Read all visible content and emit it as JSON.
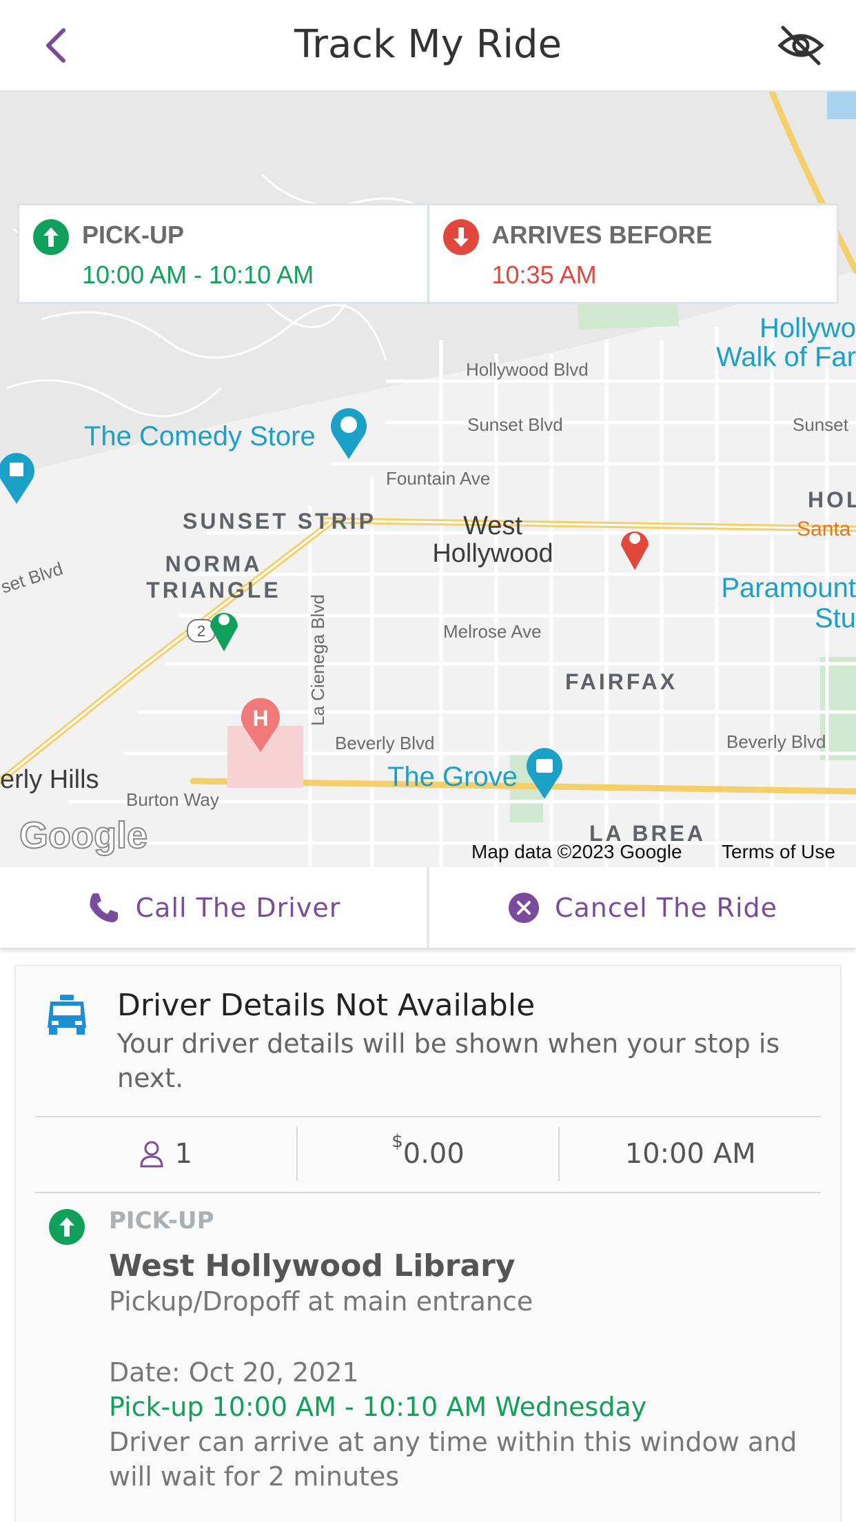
{
  "header": {
    "title": "Track My Ride",
    "back_icon": "chevron-left-icon",
    "privacy_icon": "eye-off-icon",
    "accent": "#7a4b9a"
  },
  "map": {
    "labels": {
      "hollywood_blvd": "Hollywood Blvd",
      "sunset_blvd": "Sunset Blvd",
      "sunset_blvd_right": "Sunset",
      "fountain_ave": "Fountain Ave",
      "sunset_strip": "SUNSET STRIP",
      "west_hollywood": "West Hollywood",
      "norma_triangle": "NORMA TRIANGLE",
      "la_cienega": "La Cienega Blvd",
      "melrose_ave": "Melrose Ave",
      "fairfax": "FAIRFAX",
      "beverly_blvd": "Beverly Blvd",
      "beverly_blvd_right": "Beverly Blvd",
      "burton_way": "Burton Way",
      "beverly_hills": "erly Hills",
      "la_brea": "LA BREA",
      "comedy_store": "The Comedy Store",
      "the_grove": "The Grove",
      "walk_of_fame": "Hollywo Walk of Far",
      "paramount": "Paramount Stu",
      "santa": "Santa",
      "hol": "HOL",
      "set_blvd": "set Blvd",
      "route_badge": "2"
    },
    "attribution": "Map data ©2023 Google",
    "terms": "Terms of Use",
    "google_logo": "Google"
  },
  "time_card": {
    "pickup_label": "PICK-UP",
    "pickup_value": "10:00 AM - 10:10 AM",
    "arrive_label": "ARRIVES BEFORE",
    "arrive_value": "10:35 AM",
    "green": "#11a05b",
    "red": "#e2473b"
  },
  "actions": {
    "call_label": "Call The Driver",
    "call_icon": "phone-icon",
    "cancel_label": "Cancel The Ride",
    "cancel_icon": "close-circle-icon"
  },
  "driver": {
    "icon": "taxi-icon",
    "title": "Driver Details Not Available",
    "subtitle": "Your driver details will be shown when your stop is next."
  },
  "stats": {
    "passengers": "1",
    "currency": "$",
    "fare": "0.00",
    "time": "10:00 AM"
  },
  "pickup": {
    "label": "PICK-UP",
    "place": "West Hollywood Library",
    "note": "Pickup/Dropoff at main entrance",
    "date": "Date: Oct 20, 2021",
    "window": "Pick-up 10:00 AM - 10:10 AM Wednesday",
    "wait": "Driver can arrive at any time within this window and will wait for 2 minutes"
  }
}
